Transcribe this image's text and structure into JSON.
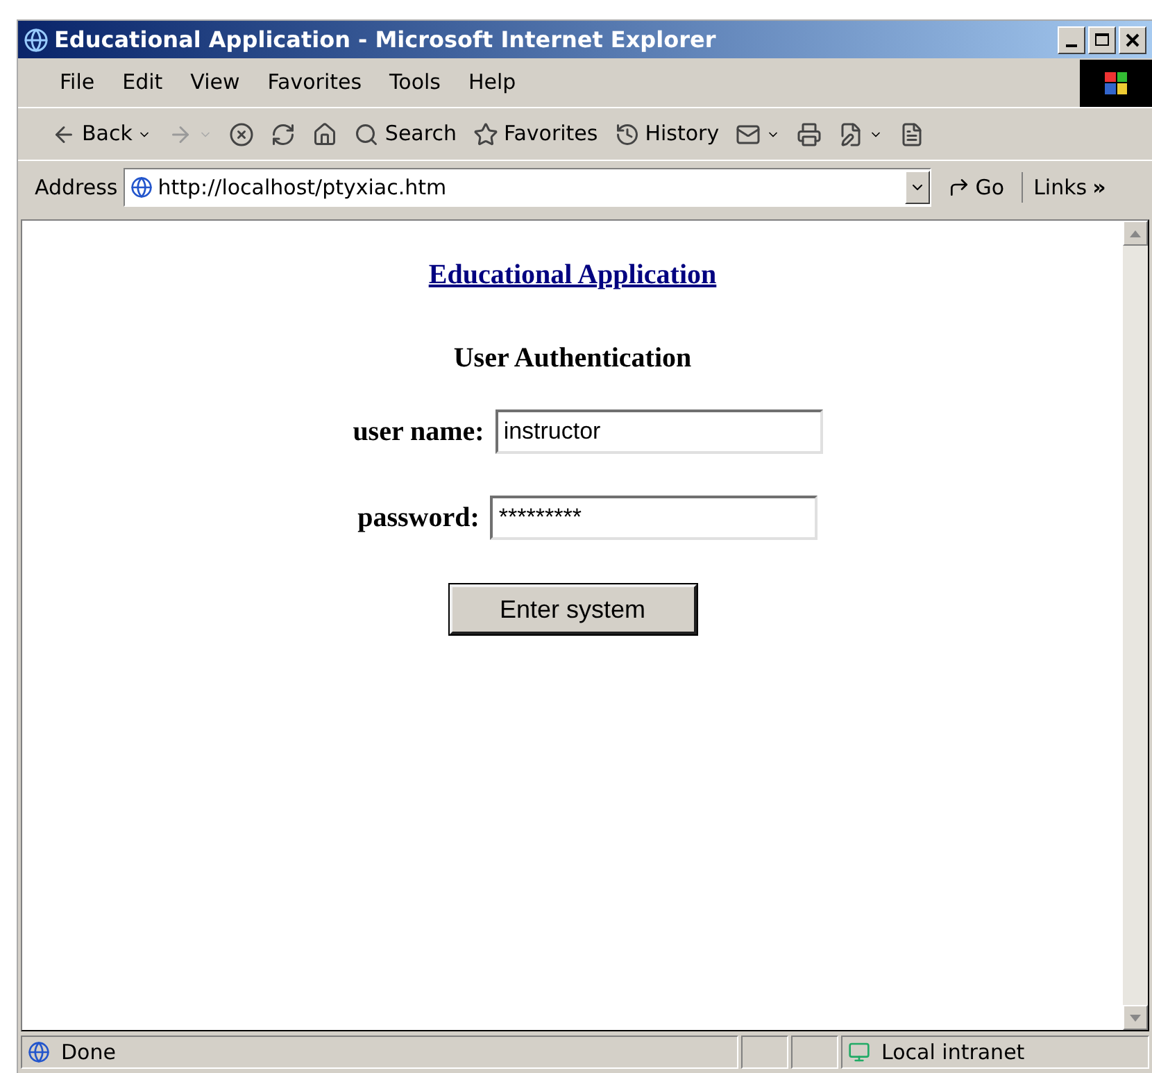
{
  "window": {
    "title": "Educational Application - Microsoft Internet Explorer"
  },
  "menu": [
    "File",
    "Edit",
    "View",
    "Favorites",
    "Tools",
    "Help"
  ],
  "toolbar": [
    {
      "kind": "back",
      "label": "Back",
      "disabled": false
    },
    {
      "kind": "forward",
      "disabled": true
    },
    {
      "kind": "stop"
    },
    {
      "kind": "refresh"
    },
    {
      "kind": "home"
    },
    {
      "kind": "search",
      "label": "Search"
    },
    {
      "kind": "favorites",
      "label": "Favorites"
    },
    {
      "kind": "history",
      "label": "History"
    },
    {
      "kind": "mail"
    },
    {
      "kind": "print"
    },
    {
      "kind": "edit"
    },
    {
      "kind": "discuss"
    }
  ],
  "address": {
    "label": "Address",
    "url": "http://localhost/ptyxiac.htm",
    "go": "Go",
    "links": "Links",
    "more": "»"
  },
  "page": {
    "title_link": "Educational Application",
    "heading": "User Authentication",
    "fields": [
      {
        "label": "user name:",
        "value": "instructor"
      },
      {
        "label": "password:",
        "value": "*********"
      }
    ],
    "submit": "Enter system"
  },
  "status_bar": {
    "text": "Done",
    "zone": "Local intranet"
  }
}
